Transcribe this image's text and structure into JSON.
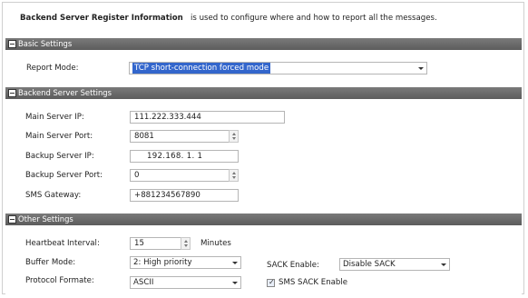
{
  "header": {
    "title_bold": "Backend Server Register Information",
    "description": "is used to configure where and how to report all the messages."
  },
  "basic": {
    "section_title": "Basic Settings",
    "report_mode_label": "Report Mode:",
    "report_mode_value": "TCP short-connection forced mode"
  },
  "backend": {
    "section_title": "Backend Server Settings",
    "main_ip_label": "Main Server IP:",
    "main_ip_value": "111.222.333.444",
    "main_port_label": "Main Server Port:",
    "main_port_value": "8081",
    "backup_ip_label": "Backup Server IP:",
    "backup_ip_value": "192.168.  1.  1",
    "backup_port_label": "Backup Server Port:",
    "backup_port_value": "0",
    "sms_gateway_label": "SMS Gateway:",
    "sms_gateway_value": "+881234567890"
  },
  "other": {
    "section_title": "Other Settings",
    "heartbeat_label": "Heartbeat Interval:",
    "heartbeat_value": "15",
    "heartbeat_unit": "Minutes",
    "buffer_label": "Buffer Mode:",
    "buffer_value": "2: High priority",
    "sack_label": "SACK Enable:",
    "sack_value": "Disable SACK",
    "protocol_label": "Protocol Formate:",
    "protocol_value": "ASCII",
    "sms_sack_label": "SMS SACK Enable",
    "sms_sack_checked": true
  },
  "colors": {
    "section_header": "#666666",
    "selection_highlight": "#3366cc"
  }
}
